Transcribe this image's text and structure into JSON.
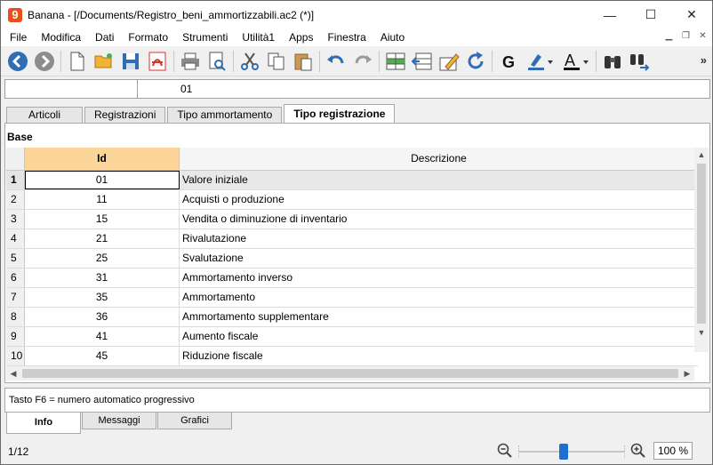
{
  "window": {
    "title": "Banana - [/Documents/Registro_beni_ammortizzabili.ac2 (*)]",
    "logo_text": "9",
    "minimize": "—",
    "maximize": "☐",
    "close": "✕"
  },
  "menu": [
    "File",
    "Modifica",
    "Dati",
    "Formato",
    "Strumenti",
    "Utilità1",
    "Apps",
    "Finestra",
    "Aiuto"
  ],
  "toolbar": {
    "more": "»"
  },
  "cellbar": {
    "ref": "",
    "value": "01"
  },
  "tabs": [
    {
      "label": "Articoli"
    },
    {
      "label": "Registrazioni"
    },
    {
      "label": "Tipo ammortamento"
    },
    {
      "label": "Tipo registrazione"
    }
  ],
  "view": {
    "name": "Base"
  },
  "table": {
    "columns": {
      "id": "Id",
      "desc": "Descrizione"
    },
    "rows": [
      {
        "n": "1",
        "id": "01",
        "desc": "Valore iniziale"
      },
      {
        "n": "2",
        "id": "11",
        "desc": "Acquisti o produzione"
      },
      {
        "n": "3",
        "id": "15",
        "desc": "Vendita o diminuzione di inventario"
      },
      {
        "n": "4",
        "id": "21",
        "desc": "Rivalutazione"
      },
      {
        "n": "5",
        "id": "25",
        "desc": "Svalutazione"
      },
      {
        "n": "6",
        "id": "31",
        "desc": "Ammortamento inverso"
      },
      {
        "n": "7",
        "id": "35",
        "desc": "Ammortamento"
      },
      {
        "n": "8",
        "id": "36",
        "desc": "Ammortamento supplementare"
      },
      {
        "n": "9",
        "id": "41",
        "desc": "Aumento fiscale"
      },
      {
        "n": "10",
        "id": "45",
        "desc": "Riduzione fiscale"
      }
    ]
  },
  "info": {
    "text": "Tasto F6 = numero automatico progressivo"
  },
  "bottom_tabs": [
    {
      "label": "Info"
    },
    {
      "label": "Messaggi"
    },
    {
      "label": "Grafici"
    }
  ],
  "status": {
    "page_count": "1/12",
    "zoom": "100 %",
    "zoom_level": 0.42
  },
  "colors": {
    "accent": "#1f6fd1",
    "header_highlight": "#fbd59a",
    "pdf_red": "#d9342b",
    "logo": "#e94e1b"
  }
}
